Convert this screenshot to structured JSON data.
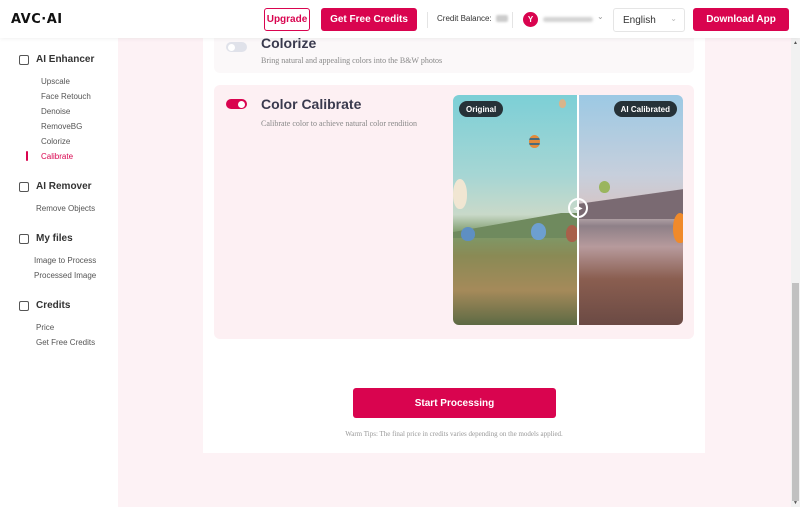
{
  "header": {
    "logo": "AVC·AI",
    "upgrade_label": "Upgrade",
    "free_credits_label": "Get Free Credits",
    "credit_balance_label": "Credit Balance:",
    "avatar_initial": "Y",
    "language": "English",
    "download_label": "Download App"
  },
  "sidebar": {
    "sections": [
      {
        "title": "AI Enhancer",
        "icon": "image-icon",
        "items": [
          "Upscale",
          "Face Retouch",
          "Denoise",
          "RemoveBG",
          "Colorize",
          "Calibrate"
        ]
      },
      {
        "title": "AI Remover",
        "icon": "edit-icon",
        "items": [
          "Remove Objects"
        ]
      },
      {
        "title": "My files",
        "icon": "files-icon",
        "items": [
          "Image to Process",
          "Processed Image"
        ]
      },
      {
        "title": "Credits",
        "icon": "wallet-icon",
        "items": [
          "Price",
          "Get Free Credits"
        ]
      }
    ],
    "active_item": "Calibrate"
  },
  "features": {
    "colorize": {
      "title": "Colorize",
      "description": "Bring natural and appealing colors into the B&W photos",
      "enabled": false
    },
    "calibrate": {
      "title": "Color Calibrate",
      "description": "Calibrate color to achieve natural color rendition",
      "enabled": true,
      "compare": {
        "left_label": "Original",
        "right_label": "AI Calibrated",
        "handle_icon": "compare-slider-icon"
      }
    }
  },
  "actions": {
    "start_label": "Start Processing",
    "tips": "Warm Tips: The final price in credits varies depending on the models applied."
  },
  "colors": {
    "accent": "#d9044f",
    "page_bg": "#fdf2f5",
    "pill_bg": "#263238"
  }
}
